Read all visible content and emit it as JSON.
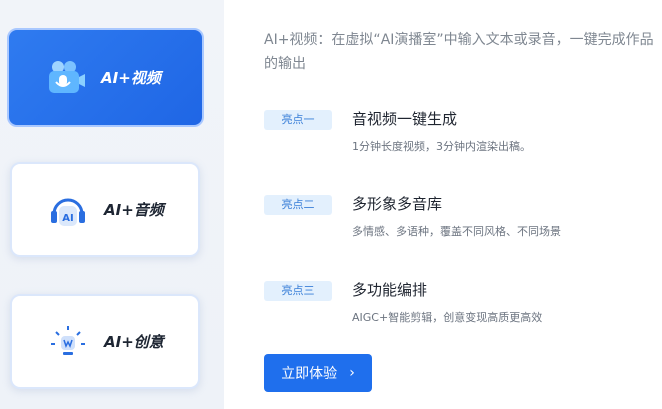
{
  "tabs": [
    {
      "label": "AI+视频",
      "icon": "video-camera-mic-icon",
      "active": true
    },
    {
      "label": "AI+音频",
      "icon": "headphones-ai-icon",
      "active": false
    },
    {
      "label": "AI+创意",
      "icon": "lightbulb-idea-icon",
      "active": false
    }
  ],
  "intro": "AI+视频：在虚拟“AI演播室”中输入文本或录音，一键完成作品的输出",
  "features": [
    {
      "badge": "亮点一",
      "title": "音视频一键生成",
      "desc": "1分钟长度视频，3分钟内渲染出稿。"
    },
    {
      "badge": "亮点二",
      "title": "多形象多音库",
      "desc": "多情感、多语种，覆盖不同风格、不同场景"
    },
    {
      "badge": "亮点三",
      "title": "多功能编排",
      "desc": "AIGC+智能剪辑，创意变现高质更高效"
    }
  ],
  "cta": {
    "label": "立即体验",
    "arrow": "›"
  },
  "colors": {
    "accent": "#1f6fed",
    "badge_bg": "#e3f0fd",
    "badge_text": "#3a7fd8"
  }
}
